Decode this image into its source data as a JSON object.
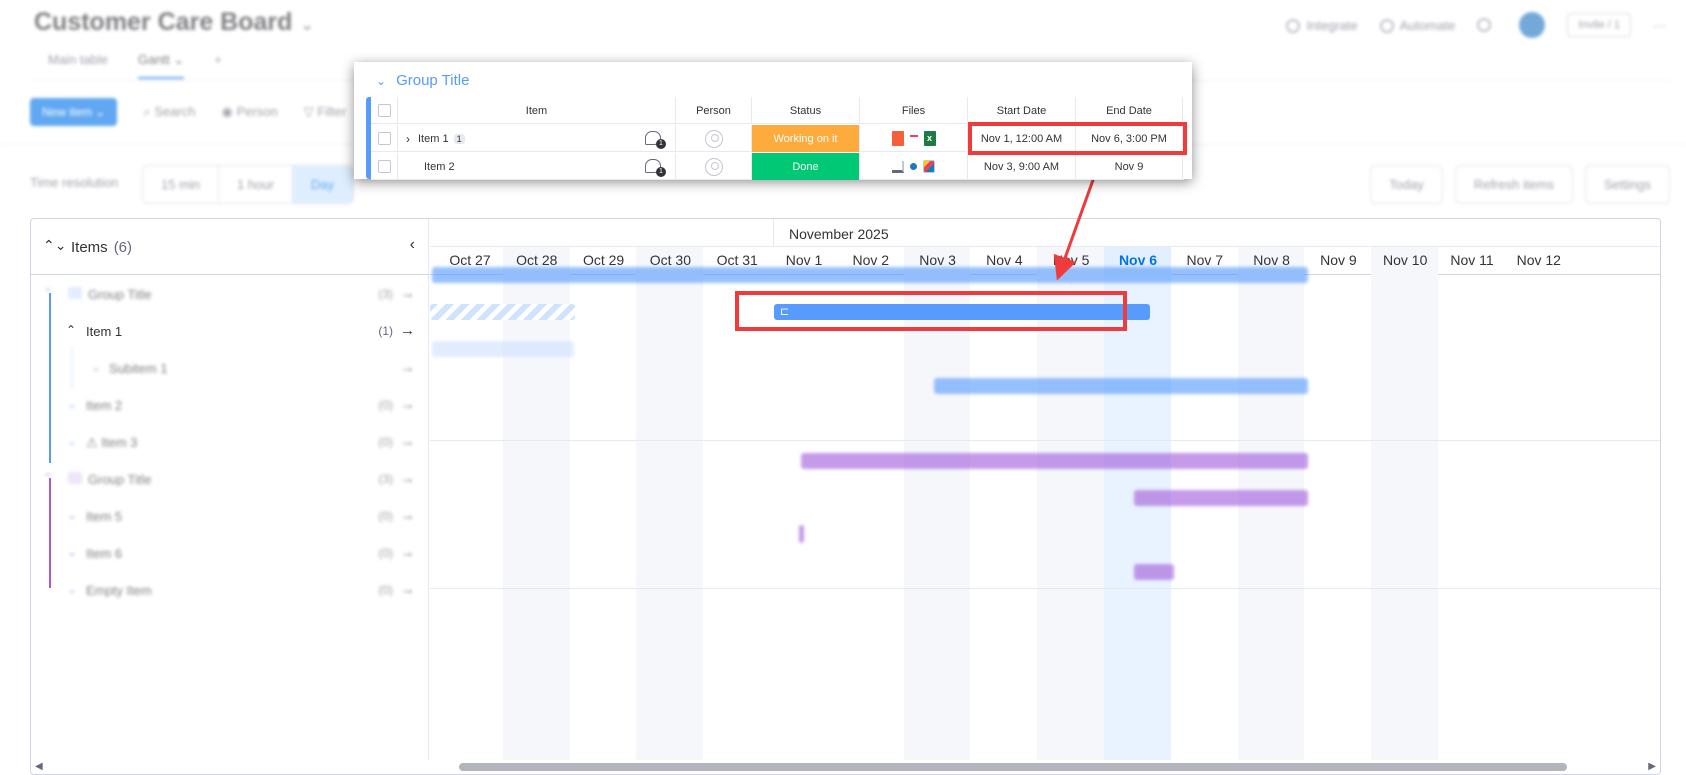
{
  "header": {
    "board_title": "Customer Care Board",
    "right": [
      "Integrate",
      "Automate"
    ],
    "invite": "Invite / 1",
    "tabs": [
      "Main table",
      "Gantt"
    ],
    "add_tab": "+",
    "toolbar": [
      "New item",
      "Search",
      "Person",
      "Filter"
    ]
  },
  "resolution": {
    "label": "Time resolution",
    "options": [
      "15 min",
      "1 hour",
      "Day"
    ],
    "selected": "Day",
    "actions": [
      "Today",
      "Refresh items",
      "Settings"
    ]
  },
  "gantt": {
    "items_label": "Items",
    "items_count": "(6)",
    "rows": [
      {
        "label": "Group Title",
        "count": "(3)",
        "color": "#579bfc"
      },
      {
        "label": "Item 1",
        "count": "(1)",
        "color": "#579bfc"
      },
      {
        "label": "Subitem 1",
        "count": "",
        "color": "#579bfc"
      },
      {
        "label": "Item 2",
        "count": "(0)",
        "color": "#579bfc"
      },
      {
        "label": "Item 3",
        "count": "(0)",
        "color": "#579bfc"
      },
      {
        "label": "Group Title",
        "count": "(3)",
        "color": "#a25ddc"
      },
      {
        "label": "Item 5",
        "count": "(0)",
        "color": "#a25ddc"
      },
      {
        "label": "Item 6",
        "count": "(0)",
        "color": "#a25ddc"
      },
      {
        "label": "Empty Item",
        "count": "(0)",
        "color": "#a25ddc"
      }
    ],
    "month": "November 2025",
    "days": [
      "Oct 27",
      "Oct 28",
      "Oct 29",
      "Oct 30",
      "Oct 31",
      "Nov 1",
      "Nov 2",
      "Nov 3",
      "Nov 4",
      "Nov 5",
      "Nov 6",
      "Nov 7",
      "Nov 8",
      "Nov 9",
      "Nov 10",
      "Nov 11",
      "Nov 12"
    ],
    "today": "Nov 6"
  },
  "popup": {
    "group_title": "Group Title",
    "columns": [
      "Item",
      "Person",
      "Status",
      "Files",
      "Start Date",
      "End Date"
    ],
    "rows": [
      {
        "item": "Item 1",
        "badge": "1",
        "updates": "1",
        "status": "Working on it",
        "status_color": "#fdab3d",
        "start": "Nov 1, 12:00 AM",
        "end": "Nov 6, 3:00 PM"
      },
      {
        "item": "Item 2",
        "badge": "",
        "updates": "1",
        "status": "Done",
        "status_color": "#00c875",
        "start": "Nov 3, 9:00 AM",
        "end": "Nov 9"
      }
    ]
  },
  "colors": {
    "accent": "#0073ea",
    "group_blue": "#579bfc",
    "group_purple": "#a25ddc",
    "highlight": "#ef3b3b",
    "today_column": "#e1efff"
  }
}
